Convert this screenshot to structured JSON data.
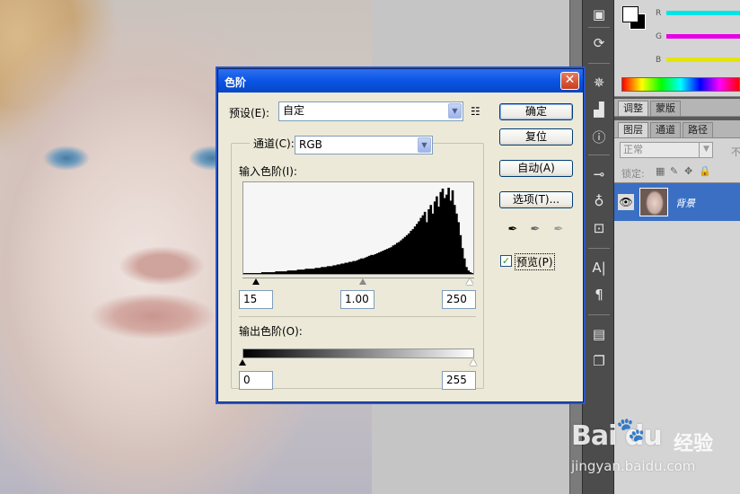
{
  "dialog": {
    "title": "色阶",
    "preset_label": "预设(E):",
    "preset_value": "自定",
    "channel_label": "通道(C):",
    "channel_value": "RGB",
    "input_levels_label": "输入色阶(I):",
    "input_black": "15",
    "input_gamma": "1.00",
    "input_white": "250",
    "output_levels_label": "输出色阶(O):",
    "output_black": "0",
    "output_white": "255",
    "buttons": {
      "ok": "确定",
      "reset": "复位",
      "auto": "自动(A)",
      "options": "选项(T)..."
    },
    "preview_label": "预览(P)",
    "preview_checked": true,
    "histogram_bins": [
      1,
      1,
      1,
      1,
      1,
      1,
      1,
      1,
      1,
      2,
      2,
      2,
      2,
      2,
      2,
      2,
      3,
      3,
      3,
      3,
      3,
      3,
      4,
      4,
      4,
      4,
      4,
      5,
      5,
      5,
      5,
      6,
      6,
      6,
      6,
      6,
      7,
      7,
      7,
      8,
      8,
      8,
      9,
      9,
      9,
      10,
      10,
      11,
      11,
      12,
      12,
      13,
      13,
      14,
      14,
      15,
      15,
      16,
      17,
      18,
      18,
      19,
      20,
      21,
      22,
      22,
      23,
      24,
      25,
      26,
      27,
      28,
      29,
      30,
      31,
      33,
      34,
      36,
      37,
      39,
      41,
      43,
      45,
      47,
      50,
      52,
      55,
      58,
      61,
      65,
      68,
      72,
      60,
      75,
      80,
      70,
      84,
      90,
      78,
      95,
      99,
      88,
      92,
      100,
      85,
      97,
      80,
      70,
      60,
      45,
      30,
      18,
      8,
      4,
      2,
      1
    ]
  },
  "right_panels": {
    "color_channels": [
      "R",
      "G",
      "B"
    ],
    "adjust_tabs": [
      "调整",
      "蒙版"
    ],
    "layer_tabs": [
      "图层",
      "通道",
      "路径"
    ],
    "blend_mode": "正常",
    "opacity_label": "不",
    "lock_label": "锁定:",
    "layer_name": "背景"
  },
  "watermark": {
    "brand": "Bai  du",
    "brand_suffix": "经验",
    "url": "jingyan.baidu.com"
  },
  "colors": {
    "title_bar": "#0a55e5",
    "dialog_bg": "#ece9d8",
    "layer_selected": "#3a6fc4",
    "channel_r": "#00e5e5",
    "channel_g": "#e500e5",
    "channel_b": "#e5e500"
  }
}
